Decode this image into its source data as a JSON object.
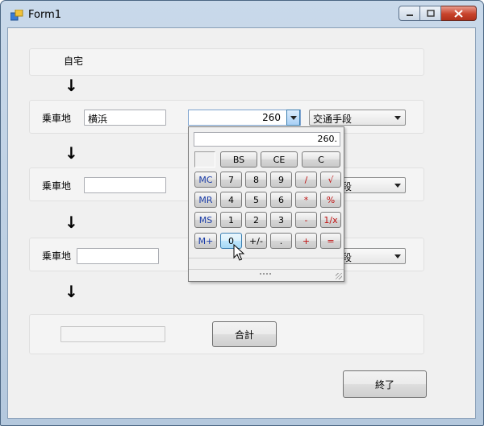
{
  "window": {
    "title": "Form1",
    "icon": "form-app-icon"
  },
  "form": {
    "home_label": "自宅",
    "arrow": "↓",
    "boarding_label": "乗車地",
    "rows": [
      {
        "station": "横浜",
        "fare": "260",
        "transport": "交通手段"
      },
      {
        "station": "",
        "fare": "",
        "transport": "交通手段"
      },
      {
        "station": "",
        "fare": "",
        "transport": "交通手段"
      }
    ],
    "total_value": "",
    "total_button": "合計",
    "exit_button": "終了"
  },
  "calculator": {
    "display": "260.",
    "top_keys": [
      "BS",
      "CE",
      "C"
    ],
    "rows": [
      [
        "MC",
        "7",
        "8",
        "9",
        "/",
        "√"
      ],
      [
        "MR",
        "4",
        "5",
        "6",
        "*",
        "%"
      ],
      [
        "MS",
        "1",
        "2",
        "3",
        "-",
        "1/x"
      ],
      [
        "M+",
        "0",
        "+/-",
        ".",
        "+",
        "="
      ]
    ],
    "footer_dots": "....."
  },
  "colors": {
    "mem_key_text": "#1a3ca8",
    "op_key_text": "#c01010",
    "hot_key": "#bee6fd"
  }
}
